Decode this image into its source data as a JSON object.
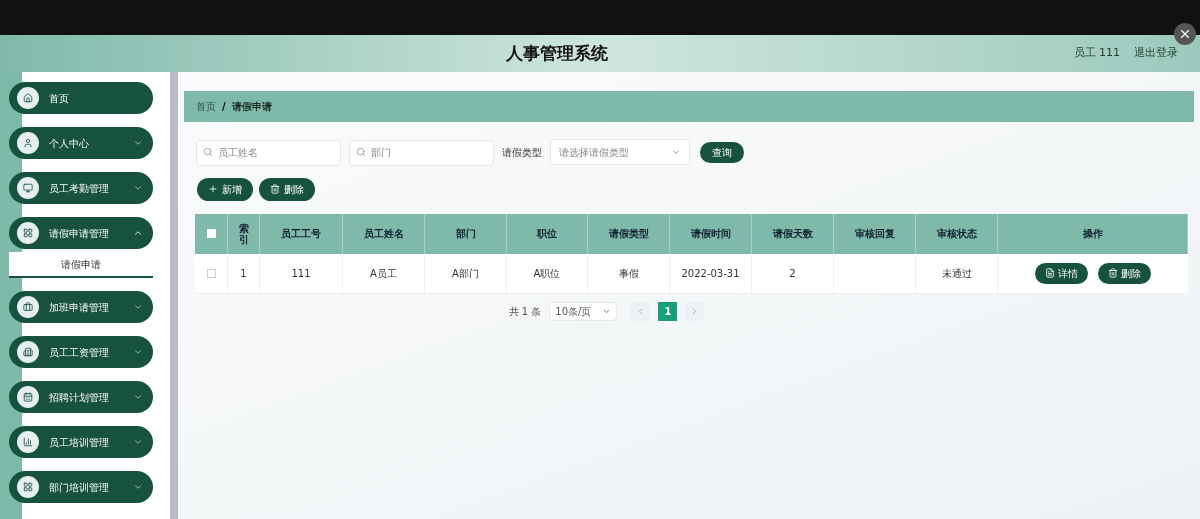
{
  "header": {
    "title": "人事管理系统",
    "user": "员工 111",
    "logout": "退出登录"
  },
  "sidebar": {
    "items": [
      {
        "label": "首页",
        "kind": "link"
      },
      {
        "label": "个人中心",
        "kind": "menu",
        "expanded": false
      },
      {
        "label": "员工考勤管理",
        "kind": "menu",
        "expanded": false
      },
      {
        "label": "请假申请管理",
        "kind": "menu",
        "expanded": true,
        "children": [
          {
            "label": "请假申请",
            "selected": true
          }
        ]
      },
      {
        "label": "加班申请管理",
        "kind": "menu",
        "expanded": false
      },
      {
        "label": "员工工资管理",
        "kind": "menu",
        "expanded": false
      },
      {
        "label": "招聘计划管理",
        "kind": "menu",
        "expanded": false
      },
      {
        "label": "员工培训管理",
        "kind": "menu",
        "expanded": false
      },
      {
        "label": "部门培训管理",
        "kind": "menu",
        "expanded": false
      }
    ]
  },
  "breadcrumb": {
    "items": [
      "首页",
      "请假申请"
    ],
    "separator": "/"
  },
  "filters": {
    "name": {
      "placeholder": "员工姓名"
    },
    "department": {
      "placeholder": "部门"
    },
    "type_label": "请假类型",
    "type": {
      "placeholder": "请选择请假类型"
    },
    "search": "查询"
  },
  "actions": [
    {
      "label": "新增",
      "kind": "add"
    },
    {
      "label": "删除",
      "kind": "delete"
    }
  ],
  "table": {
    "select_all_checked": false,
    "columns": [
      "索引",
      "员工工号",
      "员工姓名",
      "部门",
      "职位",
      "请假类型",
      "请假时间",
      "请假天数",
      "审核回复",
      "审核状态",
      "操作"
    ],
    "rows": [
      {
        "checked": false,
        "cells": [
          "1",
          "111",
          "A员工",
          "A部门",
          "A职位",
          "事假",
          "2022-03-31",
          "2",
          null,
          "未通过"
        ],
        "buttons": [
          {
            "label": "详情",
            "kind": "details"
          },
          {
            "label": "删除",
            "kind": "delete"
          }
        ]
      }
    ]
  },
  "pagination": {
    "total": "共 1 条",
    "page_size": "10条/页",
    "pages": [
      {
        "label": "1",
        "selected": true
      }
    ]
  }
}
